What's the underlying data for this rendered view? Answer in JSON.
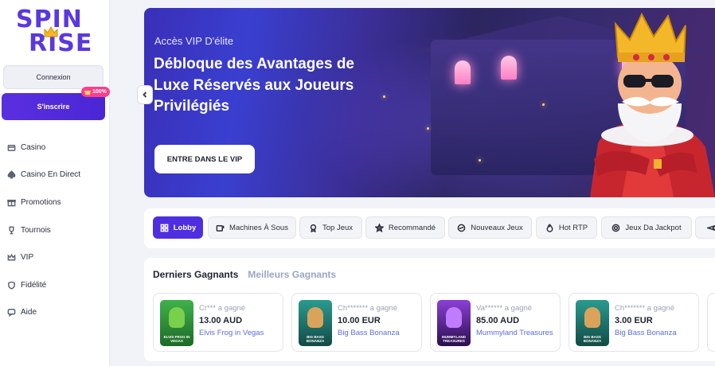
{
  "brand": {
    "line1": "SPIN",
    "line2": "RISE",
    "color": "#5a38e0"
  },
  "auth": {
    "login_label": "Connexion",
    "signup_label": "S'inscrire",
    "bonus_badge": "100%"
  },
  "sidebar": {
    "items": [
      {
        "label": "Casino",
        "icon": "casino-icon"
      },
      {
        "label": "Casino En Direct",
        "icon": "spade-icon"
      },
      {
        "label": "Promotions",
        "icon": "gift-icon"
      },
      {
        "label": "Tournois",
        "icon": "trophy-icon"
      },
      {
        "label": "VIP",
        "icon": "crown-icon"
      },
      {
        "label": "Fidélité",
        "icon": "shield-icon"
      },
      {
        "label": "Aide",
        "icon": "chat-icon"
      }
    ]
  },
  "banner": {
    "kicker": "Accès VIP D'élite",
    "headline": "Débloque des Avantages de Luxe Réservés aux Joueurs Privilégiés",
    "cta_label": "ENTRE DANS LE VIP"
  },
  "tabs": [
    {
      "label": "Lobby",
      "icon": "grid-icon",
      "active": true
    },
    {
      "label": "Machines À Sous",
      "icon": "slot-icon",
      "active": false
    },
    {
      "label": "Top Jeux",
      "icon": "medal-icon",
      "active": false
    },
    {
      "label": "Recommandé",
      "icon": "star-icon",
      "active": false
    },
    {
      "label": "Nouveaux Jeux",
      "icon": "new-icon",
      "active": false
    },
    {
      "label": "Hot RTP",
      "icon": "flame-icon",
      "active": false
    },
    {
      "label": "Jeux Da Jackpot",
      "icon": "jackpot-icon",
      "active": false
    }
  ],
  "winners": {
    "tab_latest": "Derniers Gagnants",
    "tab_best": "Meilleurs Gagnants",
    "cards": [
      {
        "winner": "Cr*** a gagné",
        "amount": "13.00 AUD",
        "game": "Elvis Frog in Vegas",
        "thumb_label": "ELVIS FROG IN VEGAS",
        "thumb_color": "#2f8f3a"
      },
      {
        "winner": "Ch******* a gagné",
        "amount": "10.00 EUR",
        "game": "Big Bass Bonanza",
        "thumb_label": "BIG BASS BONANZA",
        "thumb_color": "#1f6f6a"
      },
      {
        "winner": "Va****** a gagné",
        "amount": "85.00 AUD",
        "game": "Mummyland Treasures",
        "thumb_label": "MUMMYLAND TREASURES",
        "thumb_color": "#4a1f7a"
      },
      {
        "winner": "Ch******* a gagné",
        "amount": "3.00 EUR",
        "game": "Big Bass Bonanza",
        "thumb_label": "BIG BASS BONANZA",
        "thumb_color": "#1f6f6a"
      }
    ]
  },
  "colors": {
    "accent": "#4f2ee0",
    "link": "#5b6de0",
    "badge": "#ff3d8a"
  }
}
